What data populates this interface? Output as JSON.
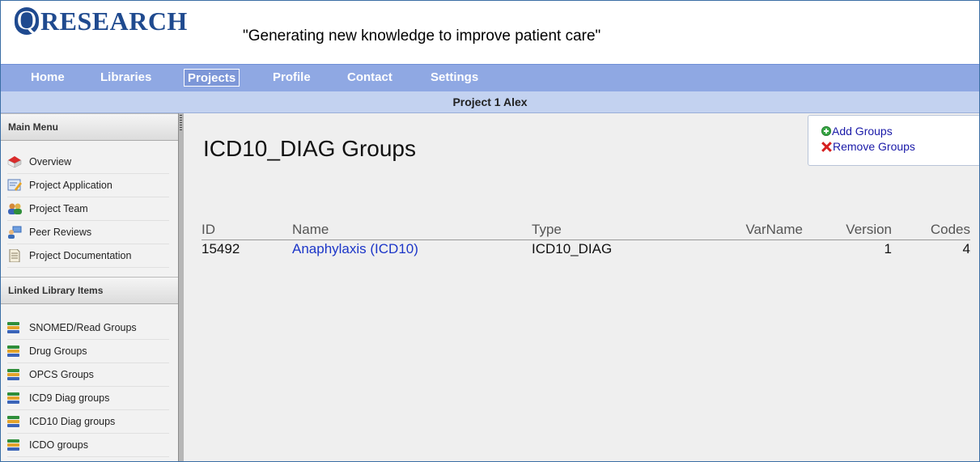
{
  "header": {
    "logo_q": "Q",
    "logo_text": "RESEARCH",
    "tagline": "\"Generating new knowledge to improve patient care\""
  },
  "nav": {
    "items": [
      "Home",
      "Libraries",
      "Projects",
      "Profile",
      "Contact",
      "Settings"
    ],
    "active": "Projects"
  },
  "project_bar": {
    "title": "Project 1 Alex"
  },
  "sidebar": {
    "main_menu_title": "Main Menu",
    "main_menu": [
      {
        "label": "Overview",
        "icon": "overview-icon"
      },
      {
        "label": "Project Application",
        "icon": "application-icon"
      },
      {
        "label": "Project Team",
        "icon": "team-icon"
      },
      {
        "label": "Peer Reviews",
        "icon": "peer-review-icon"
      },
      {
        "label": "Project Documentation",
        "icon": "document-icon"
      }
    ],
    "linked_title": "Linked Library Items",
    "linked": [
      {
        "label": "SNOMED/Read Groups",
        "icon": "books-icon"
      },
      {
        "label": "Drug Groups",
        "icon": "books-icon"
      },
      {
        "label": "OPCS Groups",
        "icon": "books-icon"
      },
      {
        "label": "ICD9 Diag groups",
        "icon": "books-icon"
      },
      {
        "label": "ICD10 Diag groups",
        "icon": "books-icon"
      },
      {
        "label": "ICDO groups",
        "icon": "books-icon"
      }
    ]
  },
  "main": {
    "title": "ICD10_DIAG Groups",
    "actions": {
      "add": "Add Groups",
      "remove": "Remove Groups"
    },
    "table": {
      "columns": [
        "ID",
        "Name",
        "Type",
        "VarName",
        "Version",
        "Codes"
      ],
      "rows": [
        {
          "id": "15492",
          "name": "Anaphylaxis (ICD10)",
          "type": "ICD10_DIAG",
          "varname": "",
          "version": "1",
          "codes": "4"
        }
      ]
    }
  },
  "colors": {
    "nav_bg": "#8fa8e3",
    "project_bar_bg": "#c3d2f0",
    "brand": "#1f4a8f",
    "link": "#1c36c8"
  }
}
